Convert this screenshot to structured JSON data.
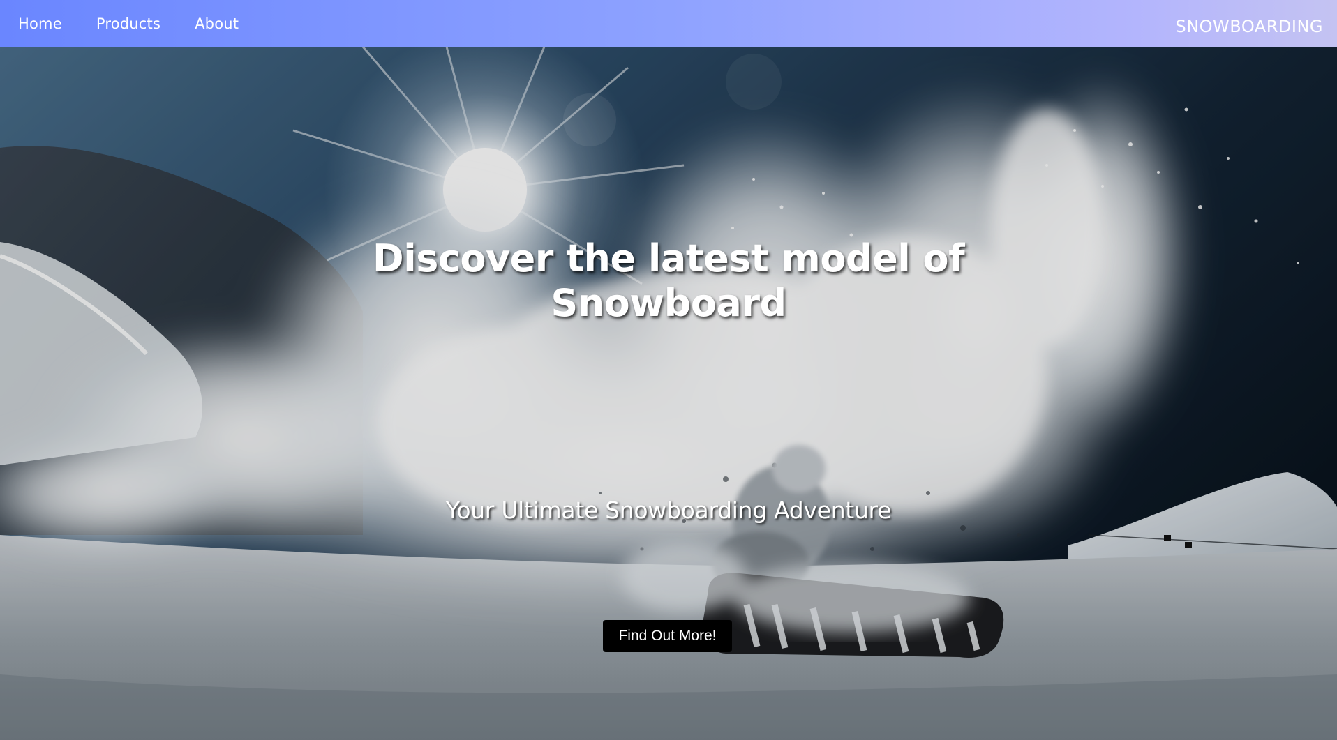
{
  "nav": {
    "links": [
      {
        "label": "Home"
      },
      {
        "label": "Products"
      },
      {
        "label": "About"
      }
    ],
    "brand": "SNOWBOARDING"
  },
  "hero": {
    "title": "Discover the latest model of Snowboard",
    "subtitle": "Your Ultimate Snowboarding Adventure",
    "cta_label": "Find Out More!"
  },
  "colors": {
    "nav_gradient_start": "#6a86ff",
    "nav_gradient_end": "#c4c3f2",
    "cta_background": "#000000",
    "text": "#ffffff"
  }
}
